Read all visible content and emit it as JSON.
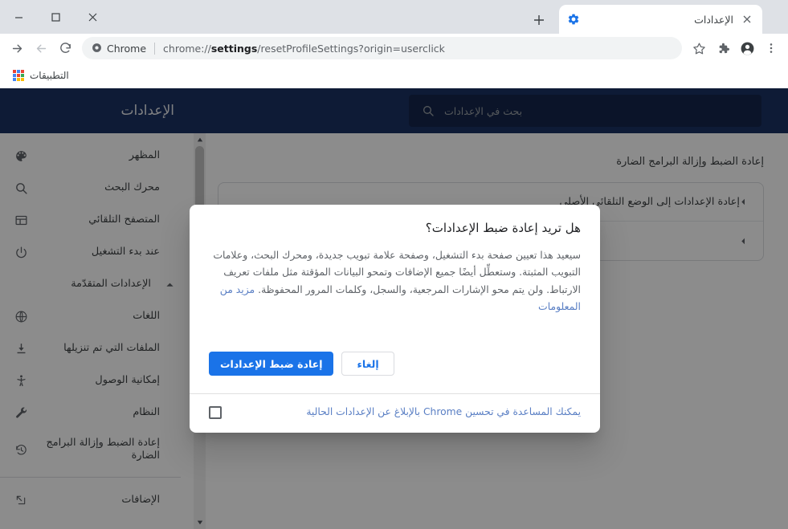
{
  "window": {
    "controls": [
      {
        "name": "close-window-button",
        "glyph": "close"
      },
      {
        "name": "maximize-window-button",
        "glyph": "maximize"
      },
      {
        "name": "minimize-window-button",
        "glyph": "minimize"
      }
    ]
  },
  "tabstrip": {
    "tab": {
      "title": "الإعدادات",
      "favicon": "gear-icon",
      "close_label": "×"
    },
    "new_tab_label": "+"
  },
  "toolbar": {
    "url_prefix": "chrome://",
    "url_bold": "settings",
    "url_suffix": "/resetProfileSettings?origin=userclick",
    "badge_label": "Chrome",
    "icons": {
      "forward": "forward-arrow-icon",
      "back": "back-arrow-icon",
      "reload": "reload-icon",
      "bookmark": "star-icon",
      "extensions": "puzzle-icon",
      "profile": "profile-avatar-icon",
      "menu": "three-dot-menu-icon"
    }
  },
  "bookmarks_bar": {
    "apps_label": "التطبيقات",
    "apps_icon": "apps-grid-icon",
    "apps_colors": [
      "#ea4335",
      "#4285f4",
      "#ea4335",
      "#34a853",
      "#ea4335",
      "#4285f4",
      "#fbbc05",
      "#fbbc05",
      "#4285f4"
    ]
  },
  "settings": {
    "brand": "الإعدادات",
    "search": {
      "placeholder": "بحث في الإعدادات",
      "value": "",
      "icon": "search-icon"
    },
    "sidebar": [
      {
        "label": "المظهر",
        "icon": "palette-icon",
        "type": "item"
      },
      {
        "label": "محرك البحث",
        "icon": "search-icon",
        "type": "item"
      },
      {
        "label": "المتصفح التلقائي",
        "icon": "browser-window-icon",
        "type": "item"
      },
      {
        "label": "عند بدء التشغيل",
        "icon": "power-icon",
        "type": "item"
      },
      {
        "label": "الإعدادات المتقدّمة",
        "icon": "chevron-up-icon",
        "type": "group"
      },
      {
        "label": "اللغات",
        "icon": "globe-icon",
        "type": "item"
      },
      {
        "label": "الملفات التي تم تنزيلها",
        "icon": "download-icon",
        "type": "item"
      },
      {
        "label": "إمكانية الوصول",
        "icon": "accessibility-icon",
        "type": "item"
      },
      {
        "label": "النظام",
        "icon": "wrench-icon",
        "type": "item"
      },
      {
        "label": "إعادة الضبط وإزالة البرامج الضارة",
        "icon": "restore-history-icon",
        "type": "item-two-line"
      }
    ],
    "sidebar_footer": {
      "label": "الإضافات",
      "icon": "external-link-icon"
    },
    "content": {
      "section_title": "إعادة الضبط وإزالة البرامج الضارة",
      "rows": [
        {
          "label": "إعادة الإعدادات إلى الوضع التلقائي الأصلي",
          "arrow": "chevron-left-icon"
        },
        {
          "label": "",
          "arrow": "chevron-left-icon"
        }
      ]
    }
  },
  "dialog": {
    "title": "هل تريد إعادة ضبط الإعدادات؟",
    "body": "سيعيد هذا تعيين صفحة بدء التشغيل، وصفحة علامة تبويب جديدة، ومحرك البحث، وعلامات التبويب المثبتة. وستعطِّل أيضًا جميع الإضافات وتمحو البيانات المؤقتة مثل ملفات تعريف الارتباط. ولن يتم محو الإشارات المرجعية، والسجل، وكلمات المرور المحفوظة. ",
    "link": "مزيد من المعلومات",
    "confirm_label": "إعادة ضبط الإعدادات",
    "cancel_label": "إلغاء",
    "checkbox_checked": false,
    "checkbox_label": "يمكنك المساعدة في تحسين Chrome بالإبلاغ عن الإعدادات الحالية"
  },
  "colors": {
    "accent": "#1a73e8",
    "header_bg": "#1a3263",
    "link": "#5a7fc4",
    "tabstrip_bg": "#dee1e6"
  }
}
